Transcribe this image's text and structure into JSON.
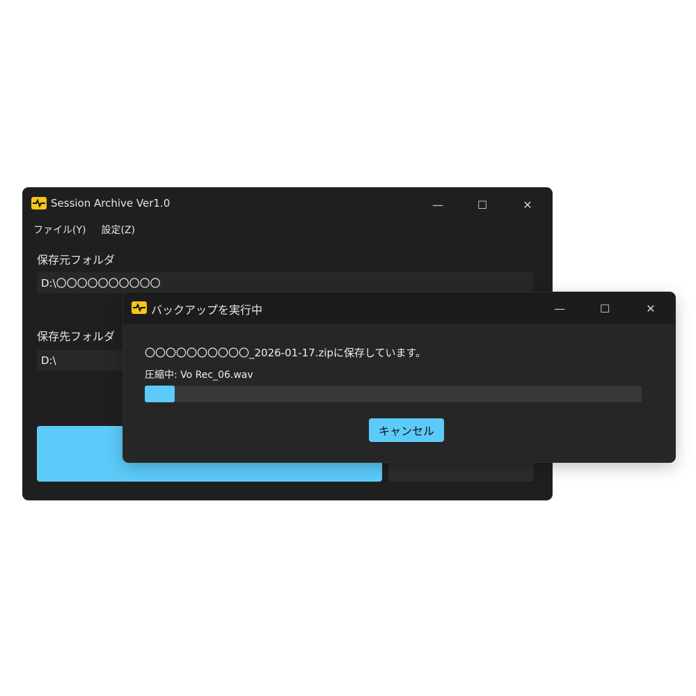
{
  "main_window": {
    "title": "Session Archive Ver1.0",
    "menu": {
      "file": "ファイル(Y)",
      "settings": "設定(Z)"
    },
    "source": {
      "label": "保存元フォルダ",
      "value": "D:\\〇〇〇〇〇〇〇〇〇〇"
    },
    "destination": {
      "label": "保存先フォルダ",
      "value": "D:\\"
    }
  },
  "dialog": {
    "title": "バックアップを実行中",
    "message": "〇〇〇〇〇〇〇〇〇〇_2026-01-17.zipに保存しています。",
    "current_file": "圧縮中: Vo Rec_06.wav",
    "progress_fraction": 0.06,
    "cancel_label": "キャンセル"
  },
  "caption_buttons": {
    "minimize": "—",
    "maximize": "☐",
    "close": "✕"
  },
  "colors": {
    "accent": "#5ccbfa",
    "icon": "#f5c518",
    "window_bg": "#1f1f1f"
  }
}
